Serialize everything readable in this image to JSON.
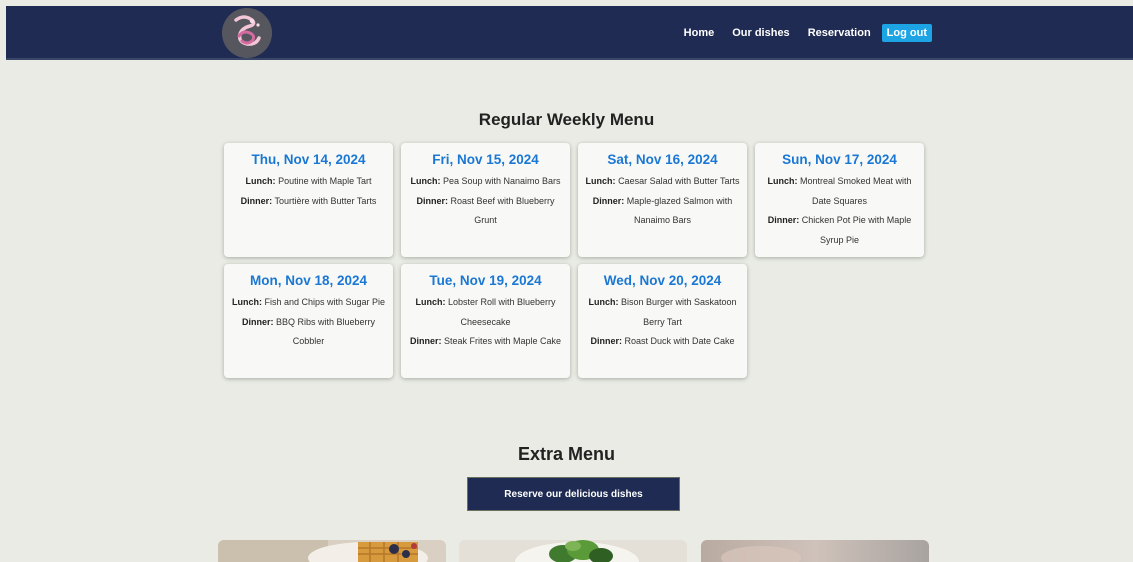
{
  "nav": {
    "links": [
      "Home",
      "Our dishes",
      "Reservation"
    ],
    "logout_label": "Log out"
  },
  "weekly_menu": {
    "title": "Regular Weekly Menu",
    "lunch_label": "Lunch:",
    "dinner_label": "Dinner:",
    "days": [
      {
        "date": "Thu, Nov 14, 2024",
        "lunch": "Poutine with Maple Tart",
        "dinner": "Tourtière with Butter Tarts"
      },
      {
        "date": "Fri, Nov 15, 2024",
        "lunch": "Pea Soup with Nanaimo Bars",
        "dinner": "Roast Beef with Blueberry Grunt"
      },
      {
        "date": "Sat, Nov 16, 2024",
        "lunch": "Caesar Salad with Butter Tarts",
        "dinner": "Maple-glazed Salmon with Nanaimo Bars"
      },
      {
        "date": "Sun, Nov 17, 2024",
        "lunch": "Montreal Smoked Meat with Date Squares",
        "dinner": "Chicken Pot Pie with Maple Syrup Pie"
      },
      {
        "date": "Mon, Nov 18, 2024",
        "lunch": "Fish and Chips with Sugar Pie",
        "dinner": "BBQ Ribs with Blueberry Cobbler"
      },
      {
        "date": "Tue, Nov 19, 2024",
        "lunch": "Lobster Roll with Blueberry Cheesecake",
        "dinner": "Steak Frites with Maple Cake"
      },
      {
        "date": "Wed, Nov 20, 2024",
        "lunch": "Bison Burger with Saskatoon Berry Tart",
        "dinner": "Roast Duck with Date Cake"
      }
    ]
  },
  "extra_menu": {
    "title": "Extra Menu",
    "reserve_label": "Reserve our delicious dishes"
  },
  "colors": {
    "navbar": "#1f2b53",
    "accent": "#1ca4e4",
    "date_blue": "#1a78d4",
    "background": "#e9ebe4"
  }
}
